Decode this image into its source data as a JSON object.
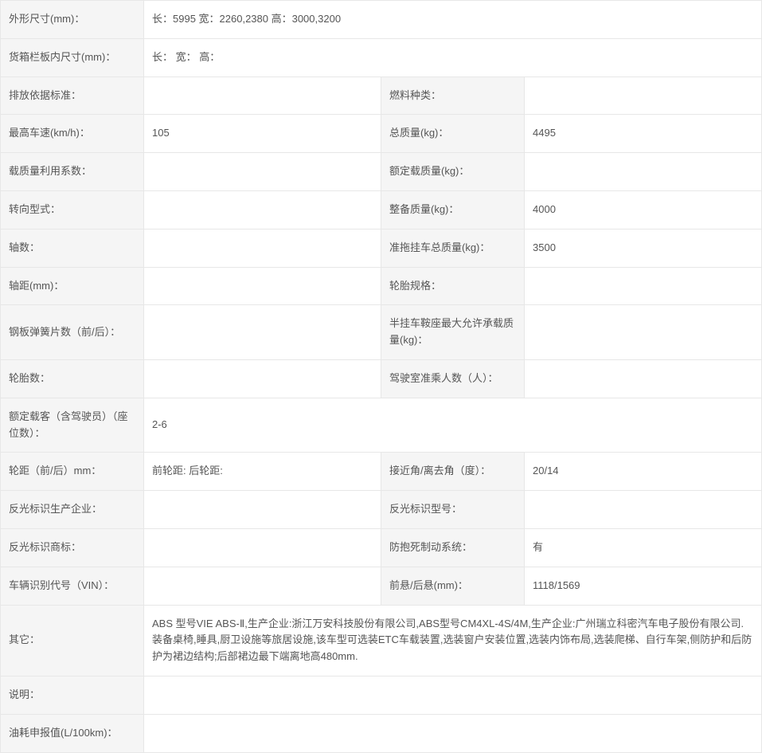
{
  "labels": {
    "outer_dim": "外形尺寸(mm)：",
    "cargo_dim": "货箱栏板内尺寸(mm)：",
    "emission_std": "排放依据标准：",
    "fuel_type": "燃料种类：",
    "max_speed": "最高车速(km/h)：",
    "gross_mass": "总质量(kg)：",
    "load_factor": "载质量利用系数：",
    "rated_mass": "额定载质量(kg)：",
    "steering": "转向型式：",
    "curb_mass": "整备质量(kg)：",
    "axles": "轴数：",
    "trailer_mass": "准拖挂车总质量(kg)：",
    "wheelbase": "轴距(mm)：",
    "tire_spec": "轮胎规格：",
    "leaf_spring": "钢板弹簧片数（前/后）：",
    "saddle_max": "半挂车鞍座最大允许承载质量(kg)：",
    "tire_count": "轮胎数：",
    "cab_pax": "驾驶室准乘人数（人）：",
    "rated_pax": "额定载客（含驾驶员）（座位数）：",
    "track": "轮距（前/后）mm：",
    "approach_angle": "接近角/离去角（度）：",
    "reflect_maker": "反光标识生产企业：",
    "reflect_model": "反光标识型号：",
    "reflect_brand": "反光标识商标：",
    "abs": "防抱死制动系统：",
    "vin": "车辆识别代号（VIN）：",
    "overhang": "前悬/后悬(mm)：",
    "other": "其它：",
    "remark": "说明：",
    "fuel_decl": "油耗申报值(L/100km)："
  },
  "values": {
    "outer_dim": "长：5995 宽：2260,2380 高：3000,3200",
    "cargo_dim": "长： 宽： 高：",
    "emission_std": "",
    "fuel_type": "",
    "max_speed": "105",
    "gross_mass": "4495",
    "load_factor": "",
    "rated_mass": "",
    "steering": "",
    "curb_mass": "4000",
    "axles": "",
    "trailer_mass": "3500",
    "wheelbase": "",
    "tire_spec": "",
    "leaf_spring": "",
    "saddle_max": "",
    "tire_count": "",
    "cab_pax": "",
    "rated_pax": "2-6",
    "track": "前轮距: 后轮距:",
    "approach_angle": "20/14",
    "reflect_maker": "",
    "reflect_model": "",
    "reflect_brand": "",
    "abs": "有",
    "vin": "",
    "overhang": "1118/1569",
    "other": "ABS 型号VIE ABS-Ⅱ,生产企业:浙江万安科技股份有限公司,ABS型号CM4XL-4S/4M,生产企业:广州瑞立科密汽车电子股份有限公司.装备桌椅,睡具,厨卫设施等旅居设施,该车型可选装ETC车载装置,选装窗户安装位置,选装内饰布局,选装爬梯、自行车架,侧防护和后防护为裙边结构;后部裙边最下端离地高480mm.",
    "remark": "",
    "fuel_decl": ""
  }
}
